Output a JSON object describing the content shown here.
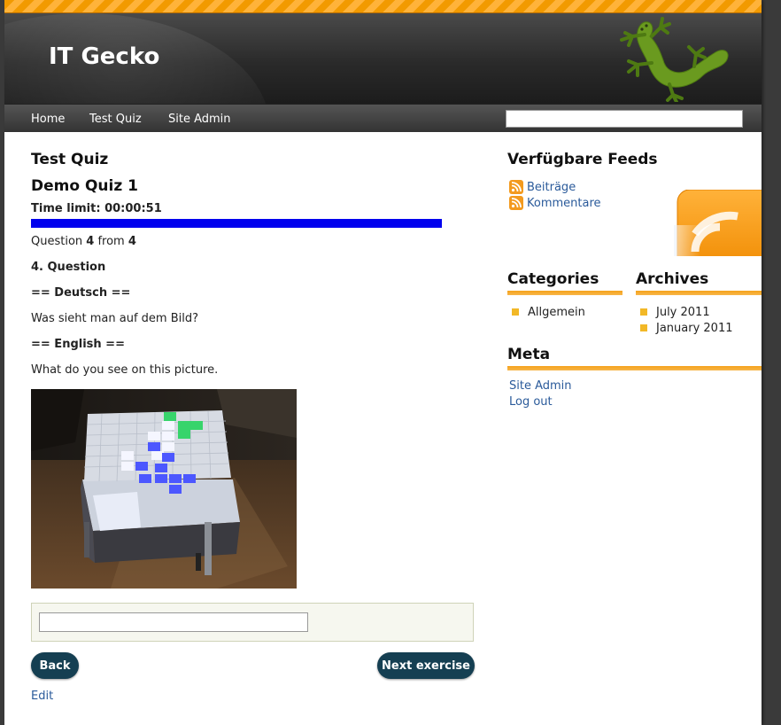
{
  "header": {
    "site_title": "IT Gecko"
  },
  "nav": {
    "items": [
      {
        "label": "Home"
      },
      {
        "label": "Test Quiz"
      },
      {
        "label": "Site Admin"
      }
    ],
    "search_value": ""
  },
  "main": {
    "page_title": "Test Quiz",
    "quiz_title": "Demo Quiz 1",
    "time_limit": "Time limit: 00:00:51",
    "progress_fraction": 1.0,
    "question_prefix": "Question ",
    "question_current": "4",
    "question_mid": " from ",
    "question_total": "4",
    "question_heading": "4. Question",
    "de_heading": "== Deutsch ==",
    "de_text": "Was sieht man auf dem Bild?",
    "en_heading": "== English ==",
    "en_text": "What do you see on this picture.",
    "answer_value": "",
    "back_label": "Back",
    "next_label": "Next exercise",
    "edit_label": "Edit"
  },
  "sidebar": {
    "feeds_title": "Verfügbare Feeds",
    "feeds": [
      {
        "label": "Beiträge"
      },
      {
        "label": "Kommentare"
      }
    ],
    "categories_title": "Categories",
    "categories": [
      {
        "label": "Allgemein"
      }
    ],
    "archives_title": "Archives",
    "archives": [
      {
        "label": "July 2011"
      },
      {
        "label": "January 2011"
      }
    ],
    "meta_title": "Meta",
    "meta_links": [
      {
        "label": "Site Admin"
      },
      {
        "label": "Log out"
      }
    ]
  },
  "colors": {
    "accent_orange": "#f29a00",
    "button_bg": "#153f52",
    "progress_fill": "#0000ee",
    "link": "#2a5a9a"
  }
}
